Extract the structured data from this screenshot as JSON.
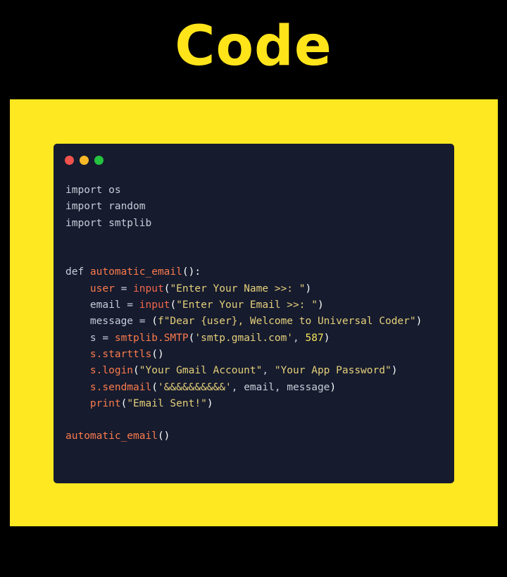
{
  "header": {
    "title": "Code"
  },
  "window": {
    "controls": [
      "close",
      "minimize",
      "maximize"
    ],
    "colors": {
      "close": "#f0524c",
      "minimize": "#f6b826",
      "maximize": "#25c240"
    }
  },
  "theme": {
    "background": "#000000",
    "frame": "#fde821",
    "editor": "#161b2e",
    "title": "#ffe41a"
  },
  "code": {
    "lines": [
      [
        {
          "t": "import os",
          "c": "k"
        }
      ],
      [
        {
          "t": "import random",
          "c": "k"
        }
      ],
      [
        {
          "t": "import smtplib",
          "c": "k"
        }
      ],
      [],
      [],
      [
        {
          "t": "def ",
          "c": "k"
        },
        {
          "t": "automatic_email",
          "c": "fn"
        },
        {
          "t": "():",
          "c": "p"
        }
      ],
      [
        {
          "t": "    ",
          "c": "k"
        },
        {
          "t": "user",
          "c": "fn"
        },
        {
          "t": " = ",
          "c": "k"
        },
        {
          "t": "input",
          "c": "fr"
        },
        {
          "t": "(",
          "c": "p"
        },
        {
          "t": "\"Enter Your Name >>: \"",
          "c": "st"
        },
        {
          "t": ")",
          "c": "p"
        }
      ],
      [
        {
          "t": "    ",
          "c": "k"
        },
        {
          "t": "email",
          "c": "k"
        },
        {
          "t": " = ",
          "c": "k"
        },
        {
          "t": "input",
          "c": "fr"
        },
        {
          "t": "(",
          "c": "p"
        },
        {
          "t": "\"Enter Your Email >>: \"",
          "c": "st"
        },
        {
          "t": ")",
          "c": "p"
        }
      ],
      [
        {
          "t": "    ",
          "c": "k"
        },
        {
          "t": "message",
          "c": "k"
        },
        {
          "t": " = ",
          "c": "k"
        },
        {
          "t": "(",
          "c": "p"
        },
        {
          "t": "f\"Dear {user}, Welcome to Universal Coder\"",
          "c": "st"
        },
        {
          "t": ")",
          "c": "p"
        }
      ],
      [
        {
          "t": "    ",
          "c": "k"
        },
        {
          "t": "s",
          "c": "k"
        },
        {
          "t": " = ",
          "c": "k"
        },
        {
          "t": "smtplib.SMTP",
          "c": "fn"
        },
        {
          "t": "(",
          "c": "p"
        },
        {
          "t": "'smtp.gmail.com'",
          "c": "st"
        },
        {
          "t": ", ",
          "c": "k"
        },
        {
          "t": "587",
          "c": "nm"
        },
        {
          "t": ")",
          "c": "p"
        }
      ],
      [
        {
          "t": "    ",
          "c": "k"
        },
        {
          "t": "s.starttls",
          "c": "fn"
        },
        {
          "t": "()",
          "c": "p"
        }
      ],
      [
        {
          "t": "    ",
          "c": "k"
        },
        {
          "t": "s.login",
          "c": "fn"
        },
        {
          "t": "(",
          "c": "p"
        },
        {
          "t": "\"Your Gmail Account\"",
          "c": "st"
        },
        {
          "t": ", ",
          "c": "k"
        },
        {
          "t": "\"Your App Password\"",
          "c": "st"
        },
        {
          "t": ")",
          "c": "p"
        }
      ],
      [
        {
          "t": "    ",
          "c": "k"
        },
        {
          "t": "s.sendmail",
          "c": "fn"
        },
        {
          "t": "(",
          "c": "p"
        },
        {
          "t": "'&&&&&&&&&&'",
          "c": "st"
        },
        {
          "t": ", email, message",
          "c": "k"
        },
        {
          "t": ")",
          "c": "p"
        }
      ],
      [
        {
          "t": "    ",
          "c": "k"
        },
        {
          "t": "print",
          "c": "fn"
        },
        {
          "t": "(",
          "c": "p"
        },
        {
          "t": "\"Email Sent!\"",
          "c": "st"
        },
        {
          "t": ")",
          "c": "p"
        }
      ],
      [],
      [
        {
          "t": "automatic_email",
          "c": "fn"
        },
        {
          "t": "()",
          "c": "p"
        }
      ]
    ]
  }
}
